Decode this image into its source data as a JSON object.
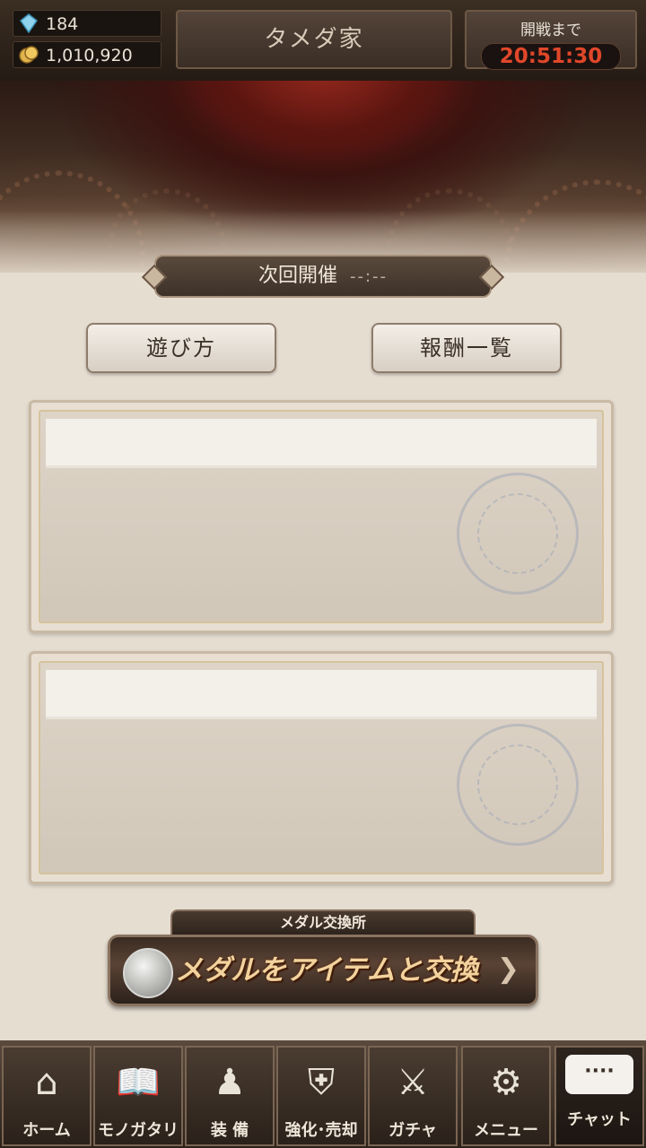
{
  "resources": {
    "gems": "184",
    "coins": "1,010,920"
  },
  "header": {
    "house_name": "タメダ家",
    "timer_label": "開戦まで",
    "timer_value": "20:51:30"
  },
  "event": {
    "next_label": "次回開催",
    "next_time": "--:--"
  },
  "buttons": {
    "howto": "遊び方",
    "rewards": "報酬一覧"
  },
  "medal": {
    "label": "メダル交換所",
    "button": "メダルをアイテムと交換"
  },
  "nav": [
    {
      "label": "ホーム",
      "icon": "home-icon",
      "glyph": "⌂"
    },
    {
      "label": "モノガタリ",
      "icon": "book-icon",
      "glyph": "📖"
    },
    {
      "label": "装 備",
      "icon": "puppet-icon",
      "glyph": "♟"
    },
    {
      "label": "強化･売却",
      "icon": "helmet-icon",
      "glyph": "⛨"
    },
    {
      "label": "ガチャ",
      "icon": "swords-icon",
      "glyph": "⚔"
    },
    {
      "label": "メニュー",
      "icon": "gears-icon",
      "glyph": "⚙"
    },
    {
      "label": "チャット",
      "icon": "chat-icon",
      "glyph": "····"
    }
  ]
}
